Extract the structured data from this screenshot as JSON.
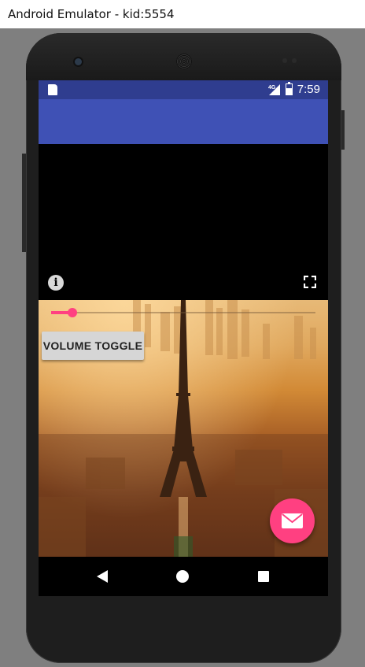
{
  "window": {
    "title": "Android Emulator - kid:5554"
  },
  "status_bar": {
    "time": "7:59",
    "network": "4G",
    "icons": [
      "sim-card-icon",
      "signal-icon",
      "battery-icon"
    ]
  },
  "app_bar": {
    "color": "#3f51b5"
  },
  "video_player": {
    "icons": [
      "info-icon",
      "fullscreen-icon"
    ],
    "volume_slider": {
      "value": 0.08
    }
  },
  "controls": {
    "volume_toggle_label": "VOLUME TOGGLE"
  },
  "fab": {
    "icon": "email-icon",
    "color": "#ff4081"
  },
  "nav_bar": {
    "icons": [
      "back-icon",
      "home-icon",
      "recents-icon"
    ]
  },
  "colors": {
    "status_bar": "#2f3d8f",
    "accent": "#ff4081"
  }
}
